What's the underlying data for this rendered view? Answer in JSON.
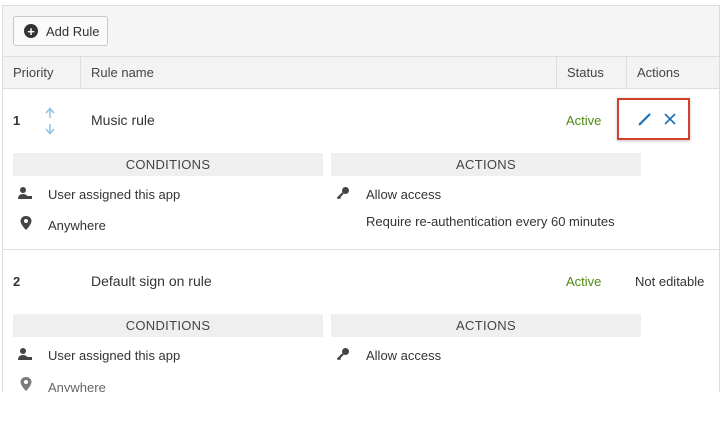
{
  "toolbar": {
    "add_rule_label": "Add Rule"
  },
  "table": {
    "headers": {
      "priority": "Priority",
      "rule_name": "Rule name",
      "status": "Status",
      "actions": "Actions"
    }
  },
  "rules": [
    {
      "priority": "1",
      "name": "Music rule",
      "status": "Active",
      "conditions_title": "CONDITIONS",
      "actions_title": "ACTIONS",
      "conditions": [
        "User assigned this app",
        "Anywhere"
      ],
      "actions": [
        "Allow access",
        "Require re-authentication every 60 minutes"
      ]
    },
    {
      "priority": "2",
      "name": "Default sign on rule",
      "status": "Active",
      "editability": "Not editable",
      "conditions_title": "CONDITIONS",
      "actions_title": "ACTIONS",
      "conditions": [
        "User assigned this app",
        "Anywhere"
      ],
      "actions": [
        "Allow access"
      ]
    }
  ],
  "colors": {
    "active": "#4f8a10",
    "icon_blue": "#1d72b8",
    "highlight": "#d5402b"
  }
}
